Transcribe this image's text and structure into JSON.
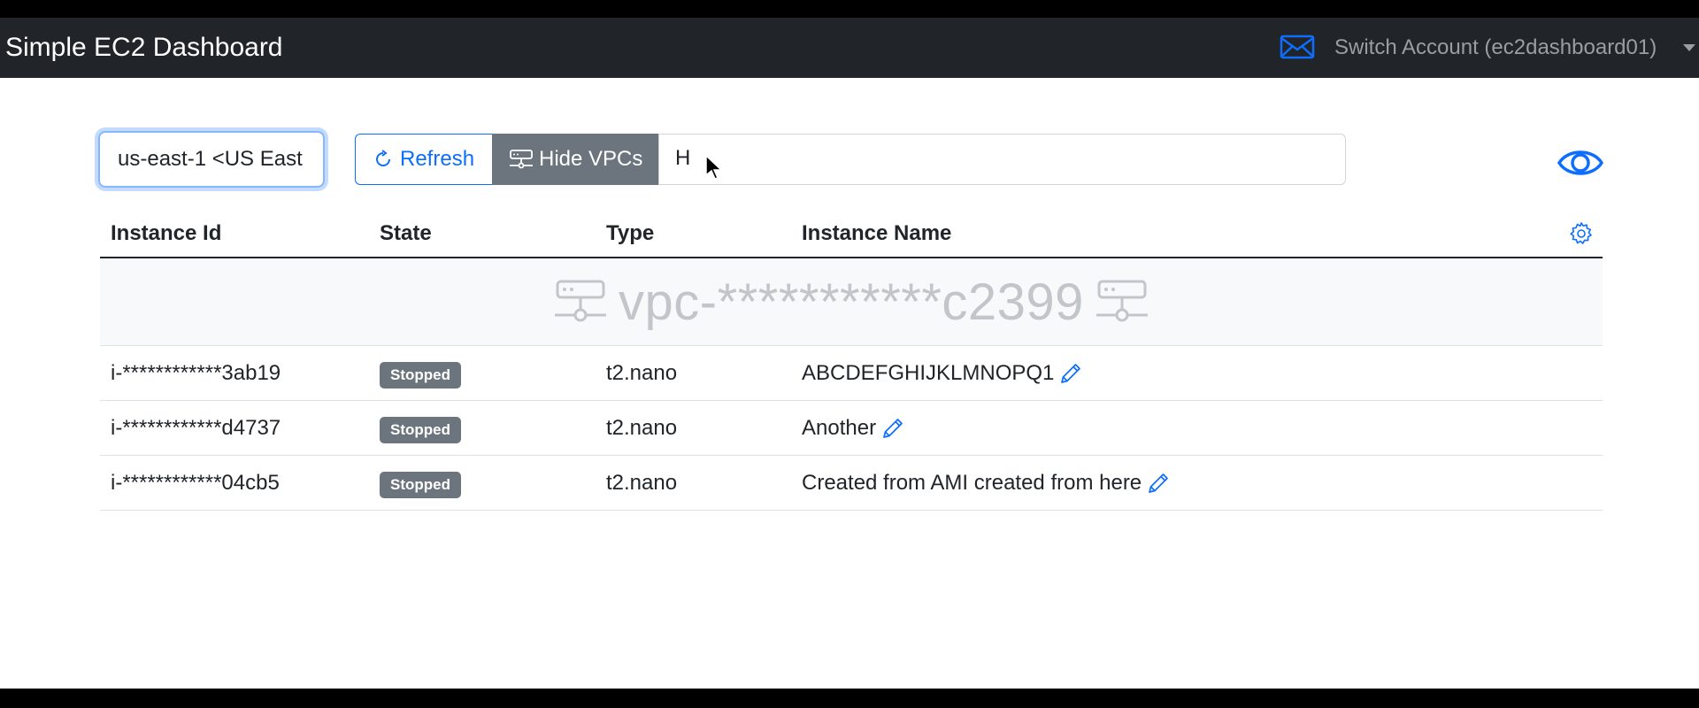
{
  "navbar": {
    "title": "Simple EC2 Dashboard",
    "account_label": "Switch Account (ec2dashboard01)",
    "mail_icon": "envelope-icon"
  },
  "toolbar": {
    "region_value": "us-east-1 <US East",
    "refresh_label": "Refresh",
    "hide_vpcs_label": "Hide VPCs",
    "filter_value": "H"
  },
  "table": {
    "columns": [
      "Instance Id",
      "State",
      "Type",
      "Instance Name"
    ],
    "vpc": "vpc-***********c2399",
    "rows": [
      {
        "id": "i-************3ab19",
        "state": "Stopped",
        "type": "t2.nano",
        "name": "ABCDEFGHIJKLMNOPQ1"
      },
      {
        "id": "i-************d4737",
        "state": "Stopped",
        "type": "t2.nano",
        "name": "Another"
      },
      {
        "id": "i-************04cb5",
        "state": "Stopped",
        "type": "t2.nano",
        "name": "Created from AMI created from here"
      }
    ]
  },
  "colors": {
    "navbar_bg": "#212529",
    "primary": "#0d6efd",
    "secondary": "#6c757d",
    "vpc_row_bg": "#f8f9fa"
  }
}
